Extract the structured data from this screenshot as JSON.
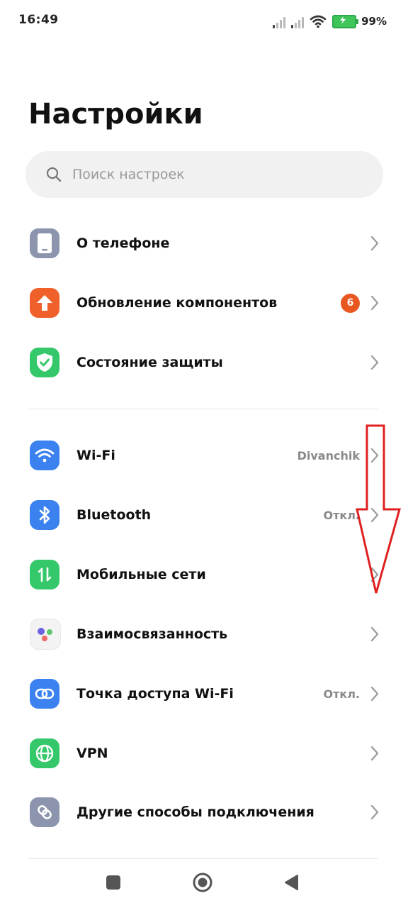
{
  "status_bar": {
    "time": "16:49",
    "battery_percent": "99%",
    "battery_level": 0.99,
    "battery_charging": true
  },
  "page": {
    "title": "Настройки"
  },
  "search": {
    "placeholder": "Поиск настроек"
  },
  "sections": [
    {
      "items": [
        {
          "label": "О телефоне",
          "icon": "phone-icon",
          "icon_bg": "#8c95ad"
        },
        {
          "label": "Обновление компонентов",
          "icon": "update-arrow-icon",
          "icon_bg": "#f0602a",
          "badge": "6"
        },
        {
          "label": "Состояние защиты",
          "icon": "shield-check-icon",
          "icon_bg": "#35c86a"
        }
      ]
    },
    {
      "items": [
        {
          "label": "Wi-Fi",
          "icon": "wifi-icon",
          "icon_bg": "#3b82f0",
          "value": "Divanchik"
        },
        {
          "label": "Bluetooth",
          "icon": "bluetooth-icon",
          "icon_bg": "#3b82f0",
          "value": "Откл."
        },
        {
          "label": "Мобильные сети",
          "icon": "mobile-data-icon",
          "icon_bg": "#35c86a"
        },
        {
          "label": "Взаимосвязанность",
          "icon": "interconnect-icon",
          "icon_bg": "#f3f3f3"
        },
        {
          "label": "Точка доступа Wi-Fi",
          "icon": "hotspot-link-icon",
          "icon_bg": "#3b82f0",
          "value": "Откл."
        },
        {
          "label": "VPN",
          "icon": "globe-icon",
          "icon_bg": "#35c86a"
        },
        {
          "label": "Другие способы подключения",
          "icon": "other-connection-icon",
          "icon_bg": "#8c95ad"
        }
      ]
    }
  ],
  "colors": {
    "accent_red_annotation": "#e02020",
    "badge": "#e8571f"
  }
}
